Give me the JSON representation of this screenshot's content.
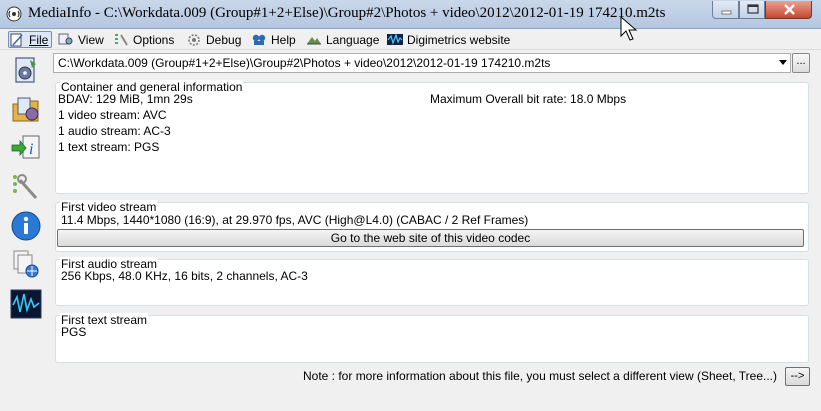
{
  "window": {
    "title": "MediaInfo - C:\\Workdata.009 (Group#1+2+Else)\\Group#2\\Photos + video\\2012\\2012-01-19 174210.m2ts"
  },
  "menu": {
    "items": [
      {
        "label": "File",
        "icon": "file-view-icon"
      },
      {
        "label": "View",
        "icon": "view-icon"
      },
      {
        "label": "Options",
        "icon": "options-icon"
      },
      {
        "label": "Debug",
        "icon": "debug-icon"
      },
      {
        "label": "Help",
        "icon": "help-icon"
      },
      {
        "label": "Language",
        "icon": "language-icon"
      },
      {
        "label": "Digimetrics website",
        "icon": "digimetrics-icon"
      }
    ]
  },
  "sidebar": {
    "icons": [
      "open-file-icon",
      "open-folder-icon",
      "export-icon",
      "preferences-icon",
      "about-icon",
      "knowledge-base-icon",
      "digimetrics-icon"
    ]
  },
  "file_selector": {
    "value": "C:\\Workdata.009 (Group#1+2+Else)\\Group#2\\Photos + video\\2012\\2012-01-19 174210.m2ts",
    "button_label": "..."
  },
  "container": {
    "title": "Container and general information",
    "format_line": "BDAV: 129 MiB, 1mn 29s",
    "bitrate_line": "Maximum Overall bit rate: 18.0 Mbps",
    "video_count": "1 video stream: AVC",
    "audio_count": "1 audio stream: AC-3",
    "text_count": "1 text stream: PGS"
  },
  "video": {
    "title": "First video stream",
    "details": "11.4 Mbps, 1440*1080 (16:9), at 29.970 fps, AVC (High@L4.0) (CABAC / 2 Ref Frames)",
    "codec_button": "Go to the web site of this video codec"
  },
  "audio": {
    "title": "First audio stream",
    "details": "256 Kbps, 48.0 KHz, 16 bits, 2 channels, AC-3"
  },
  "text": {
    "title": "First text stream",
    "details": "PGS"
  },
  "footer": {
    "note": "Note : for more information about this file, you must select a different view (Sheet, Tree...)",
    "more_button": "-->"
  }
}
